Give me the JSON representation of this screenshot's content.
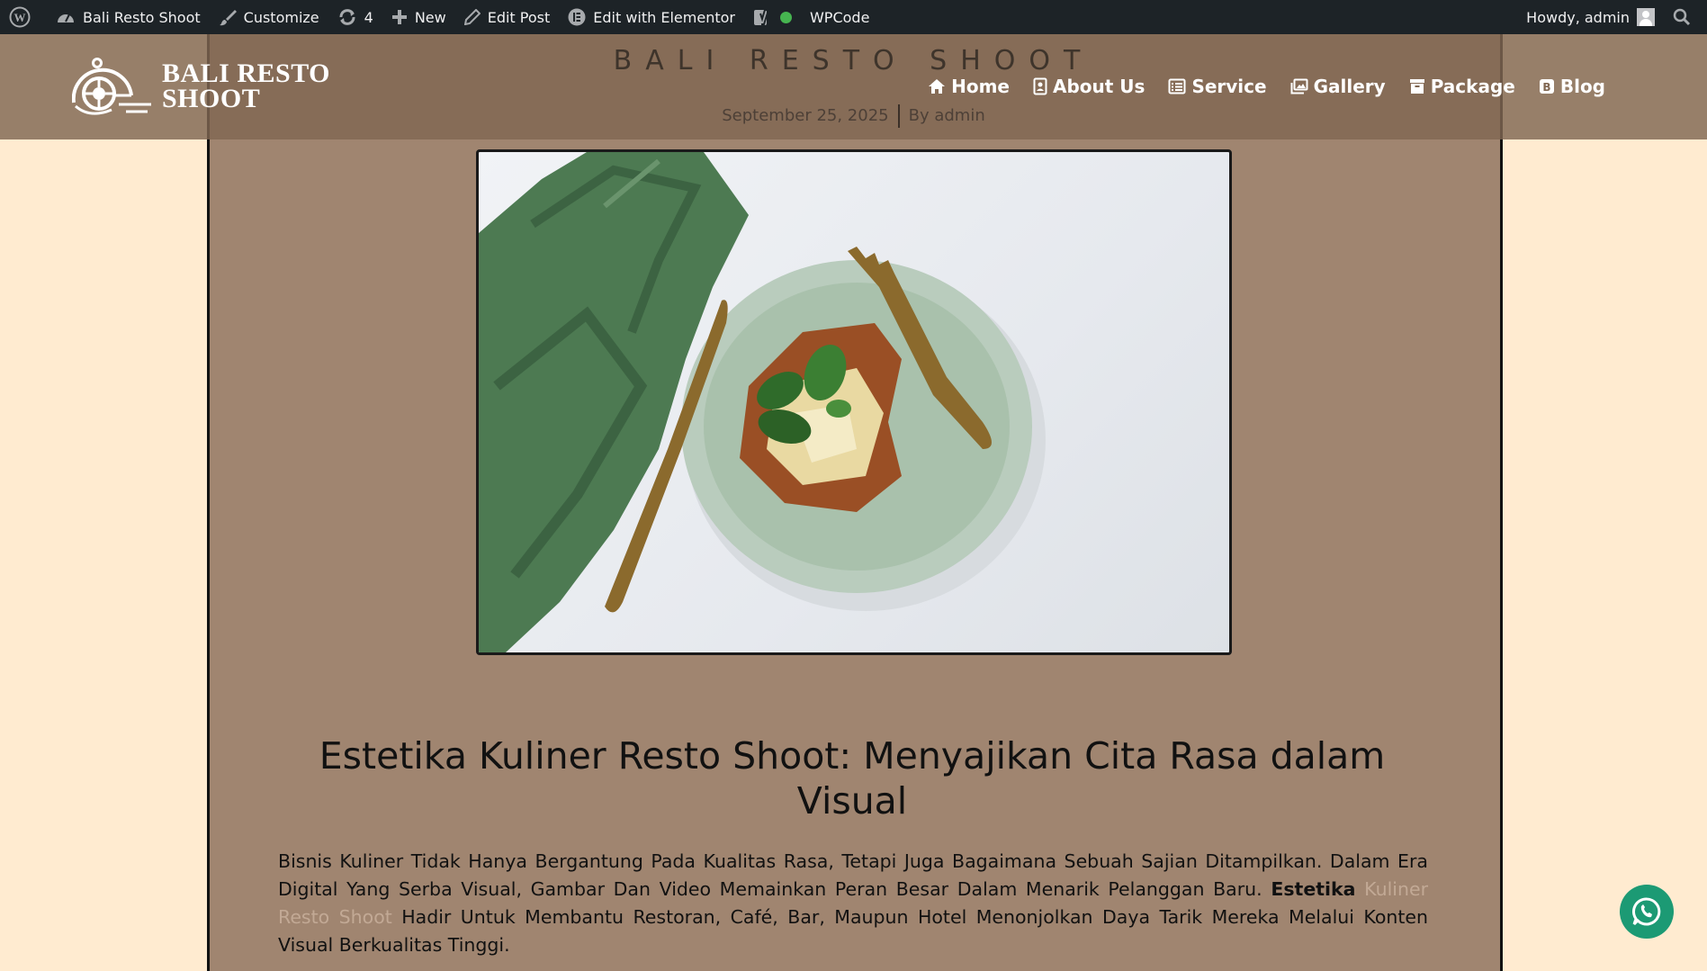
{
  "admin_bar": {
    "site_name": "Bali Resto Shoot",
    "customize": "Customize",
    "updates_count": "4",
    "new": "New",
    "edit_post": "Edit Post",
    "edit_elementor": "Edit with Elementor",
    "wpcode": "WPCode",
    "howdy": "Howdy, admin"
  },
  "header": {
    "logo_line1": "BALI RESTO",
    "logo_line2": "SHOOT",
    "site_title": "BALI RESTO SHOOT",
    "post_date": "September 25, 2025",
    "post_author": "By admin"
  },
  "nav": {
    "items": [
      {
        "label": "Home",
        "icon": "home-icon"
      },
      {
        "label": "About Us",
        "icon": "contact-card-icon"
      },
      {
        "label": "Service",
        "icon": "list-icon"
      },
      {
        "label": "Gallery",
        "icon": "images-icon"
      },
      {
        "label": "Package",
        "icon": "archive-icon"
      },
      {
        "label": "Blog",
        "icon": "blog-icon"
      }
    ]
  },
  "article": {
    "title": "Estetika Kuliner Resto Shoot: Menyajikan Cita Rasa dalam Visual",
    "p1_part1": "Bisnis Kuliner Tidak Hanya Bergantung Pada Kualitas Rasa, Tetapi Juga Bagaimana Sebuah Sajian Ditampilkan. Dalam Era Digital Yang Serba Visual, Gambar Dan Video Memainkan Peran Besar Dalam Menarik Pelanggan Baru.",
    "p1_bold": "Estetika",
    "p1_link": "Kuliner Resto Shoot",
    "p1_part2": "Hadir Untuk Membantu Restoran, Café, Bar, Maupun Hotel Menonjolkan Daya Tarik Mereka Melalui Konten Visual Berkualitas Tinggi."
  },
  "colors": {
    "page_bg": "#ffebd0",
    "column_bg": "#a08570",
    "header_overlay": "#806752",
    "admin_bar": "#1d2327",
    "whatsapp": "#1c9a74",
    "link": "#c2a995"
  }
}
